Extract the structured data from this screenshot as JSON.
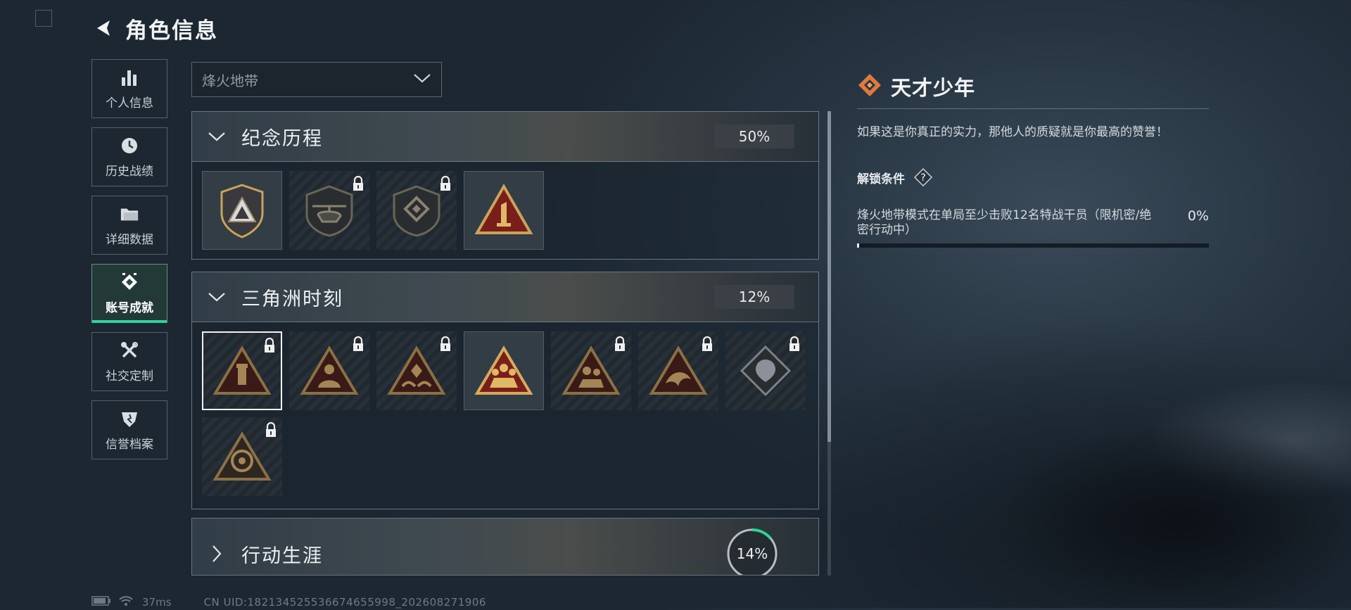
{
  "header": {
    "title": "角色信息"
  },
  "sidebar": {
    "items": [
      {
        "label": "个人信息",
        "icon": "bar-chart-icon",
        "active": false
      },
      {
        "label": "历史战绩",
        "icon": "clock-icon",
        "active": false
      },
      {
        "label": "详细数据",
        "icon": "folder-icon",
        "active": false
      },
      {
        "label": "账号成就",
        "icon": "achievement-icon",
        "active": true
      },
      {
        "label": "社交定制",
        "icon": "tools-icon",
        "active": false
      },
      {
        "label": "信誉档案",
        "icon": "shield-star-icon",
        "active": false
      }
    ]
  },
  "mode_select": {
    "value": "烽火地带"
  },
  "categories": [
    {
      "title": "纪念历程",
      "percent": "50%",
      "expanded": true
    },
    {
      "title": "三角洲时刻",
      "percent": "12%",
      "expanded": true
    },
    {
      "title": "行动生涯",
      "percent": "14%",
      "expanded": false,
      "progress": 0.14
    }
  ],
  "detail": {
    "title": "天才少年",
    "description": "如果这是你真正的实力，那他人的质疑就是你最高的赞誉！",
    "condition_label": "解锁条件",
    "condition_text": "烽火地带模式在单局至少击败12名特战干员（限机密/绝密行动中）",
    "condition_percent": "0%",
    "condition_progress": 0.0
  },
  "status_bar": {
    "ping": "37ms",
    "uid": "CN UID:18213452553667465599​8_202608271906"
  },
  "colors": {
    "accent_green": "#2fd39a",
    "badge_gold": "#c9a45a",
    "badge_red": "#7a1e1a",
    "diamond_orange": "#e07a3a"
  }
}
